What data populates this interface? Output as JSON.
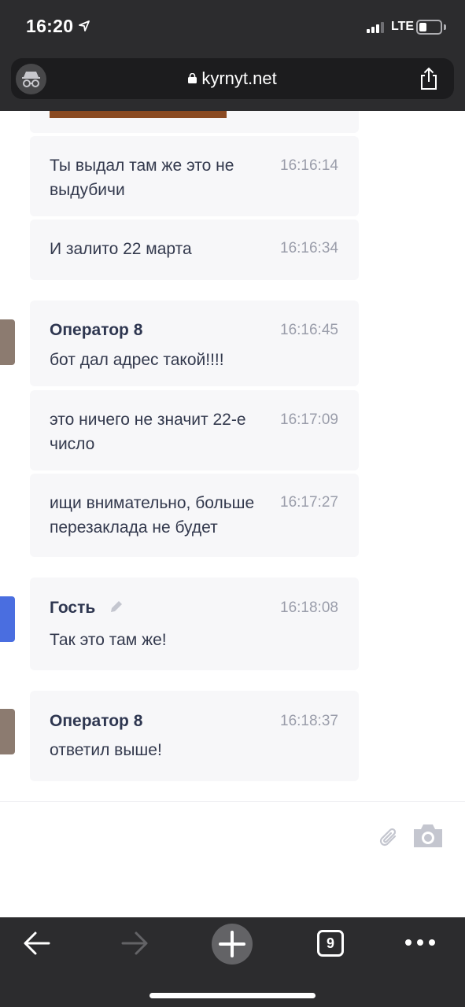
{
  "status_bar": {
    "time": "16:20",
    "network": "LTE"
  },
  "browser": {
    "url": "kyrnyt.net",
    "open_tabs": "9"
  },
  "messages": [
    {
      "sender": "",
      "text": "Ты выдал там же это не выдубичи",
      "time": "16:16:14"
    },
    {
      "sender": "",
      "text": "И залито 22 марта",
      "time": "16:16:34"
    },
    {
      "sender": "Оператор 8",
      "text": "бот дал адрес такой!!!!",
      "time": "16:16:45"
    },
    {
      "sender": "",
      "text": "это ничего не значит 22-е число",
      "time": "16:17:09"
    },
    {
      "sender": "",
      "text": "ищи внимательно, больше перезаклада не будет",
      "time": "16:17:27"
    },
    {
      "sender": "Гость",
      "text": "Так это там же!",
      "time": "16:18:08"
    },
    {
      "sender": "Оператор 8",
      "text": "ответил выше!",
      "time": "16:18:37"
    }
  ],
  "colors": {
    "operator_avatar": "#8c7b70",
    "guest_avatar": "#4a6ee0",
    "bubble_bg": "#f7f7f9",
    "browser_chrome": "#2c2c2e"
  },
  "icons": {
    "location": "location-arrow-icon",
    "incognito": "incognito-icon",
    "lock": "lock-icon",
    "share": "share-icon",
    "edit": "pencil-icon",
    "attach": "paperclip-icon",
    "camera": "camera-icon",
    "back": "back-arrow-icon",
    "forward": "forward-arrow-icon",
    "new_tab": "plus-icon",
    "more": "more-dots-icon"
  }
}
